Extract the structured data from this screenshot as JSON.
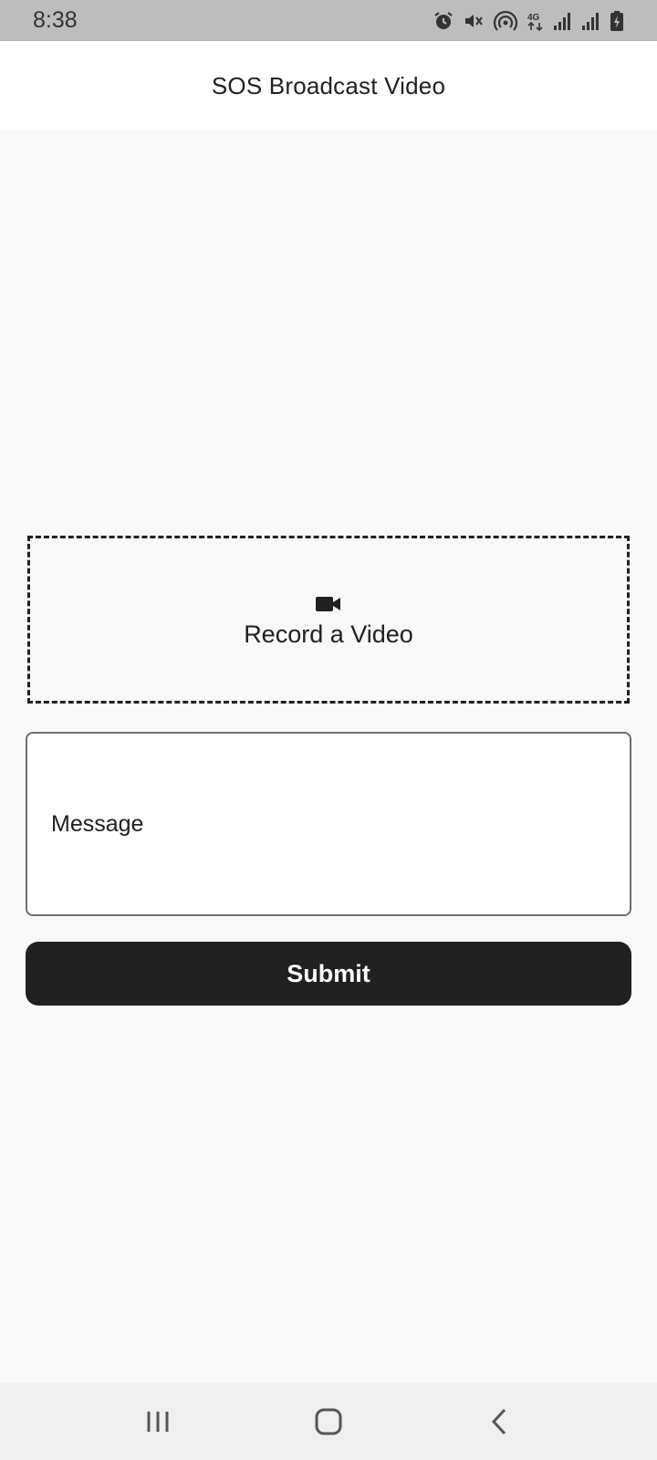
{
  "status_bar": {
    "time": "8:38",
    "icons": [
      "alarm-icon",
      "mute-icon",
      "hotspot-icon",
      "4g-icon",
      "signal-icon",
      "signal-icon",
      "battery-charging-icon"
    ],
    "network_label": "4G"
  },
  "app_bar": {
    "title": "SOS Broadcast Video"
  },
  "record": {
    "icon": "video-camera-icon",
    "label": "Record a Video"
  },
  "message": {
    "placeholder": "Message",
    "value": ""
  },
  "submit": {
    "label": "Submit"
  },
  "nav_bar": {
    "buttons": [
      "recent-apps-icon",
      "home-icon",
      "back-icon"
    ]
  },
  "colors": {
    "status_bar_bg": "#bdbdbd",
    "app_bar_bg": "#ffffff",
    "page_bg": "#f9f9f9",
    "primary_dark": "#212121",
    "nav_bar_bg": "#efefef"
  }
}
